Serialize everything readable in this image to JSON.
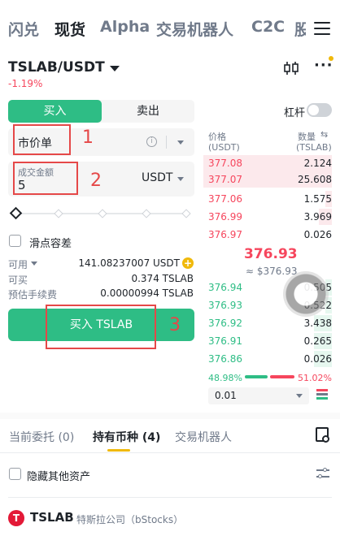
{
  "nav": {
    "tabs": [
      "闪兑",
      "现货",
      "Alpha",
      "交易机器人",
      "C2C",
      "股"
    ],
    "active": "现货"
  },
  "pair": {
    "symbol": "TSLAB/USDT",
    "change": "-1.19%"
  },
  "trade": {
    "buy_tab": "买入",
    "sell_tab": "卖出",
    "leverage_label": "杠杆",
    "order_type": "市价单",
    "amount_label": "成交金额",
    "amount_value": "5",
    "amount_unit": "USDT",
    "slider_percent": 0,
    "slippage_label": "滑点容差",
    "available_label": "可用",
    "available_value": "141.08237007 USDT",
    "can_buy_label": "可买",
    "can_buy_value": "0.374 TSLAB",
    "fee_label": "预估手续费",
    "fee_value": "0.00000994 TSLAB",
    "buy_button": "买入 TSLAB"
  },
  "orderbook": {
    "price_header": "价格",
    "price_unit": "(USDT)",
    "qty_header": "数量",
    "qty_unit": "(TSLAB)",
    "asks": [
      {
        "price": "377.08",
        "qty": "2.124"
      },
      {
        "price": "377.07",
        "qty": "25.608"
      },
      {
        "price": "377.06",
        "qty": "1.575"
      },
      {
        "price": "376.99",
        "qty": "3.969"
      },
      {
        "price": "376.97",
        "qty": "0.026"
      }
    ],
    "mid_price": "376.93",
    "mid_usd": "≈ $376.93",
    "bids": [
      {
        "price": "376.94",
        "qty": "0.505"
      },
      {
        "price": "376.93",
        "qty": "0.522"
      },
      {
        "price": "376.92",
        "qty": "3.438"
      },
      {
        "price": "376.91",
        "qty": "0.265"
      },
      {
        "price": "376.86",
        "qty": "0.026"
      }
    ],
    "buy_ratio": "48.98%",
    "sell_ratio": "51.02%",
    "precision": "0.01"
  },
  "bottom": {
    "tabs": [
      "当前委托 (0)",
      "持有币种 (4)",
      "交易机器人"
    ],
    "active_index": 1,
    "hide_label": "隐藏其他资产",
    "asset_symbol": "TSLAB",
    "asset_name": "特斯拉公司（bStocks）",
    "asset_logo": "T"
  },
  "annotations": [
    "1",
    "2",
    "3"
  ],
  "colors": {
    "buy": "#2ebd85",
    "sell": "#f6465d",
    "accent": "#f0b90b",
    "annotation": "#e54848"
  },
  "icons": [
    "menu-icon",
    "candlestick-icon",
    "more-icon",
    "info-icon",
    "plus-icon",
    "layout-icon",
    "history-icon",
    "filter-icon"
  ]
}
